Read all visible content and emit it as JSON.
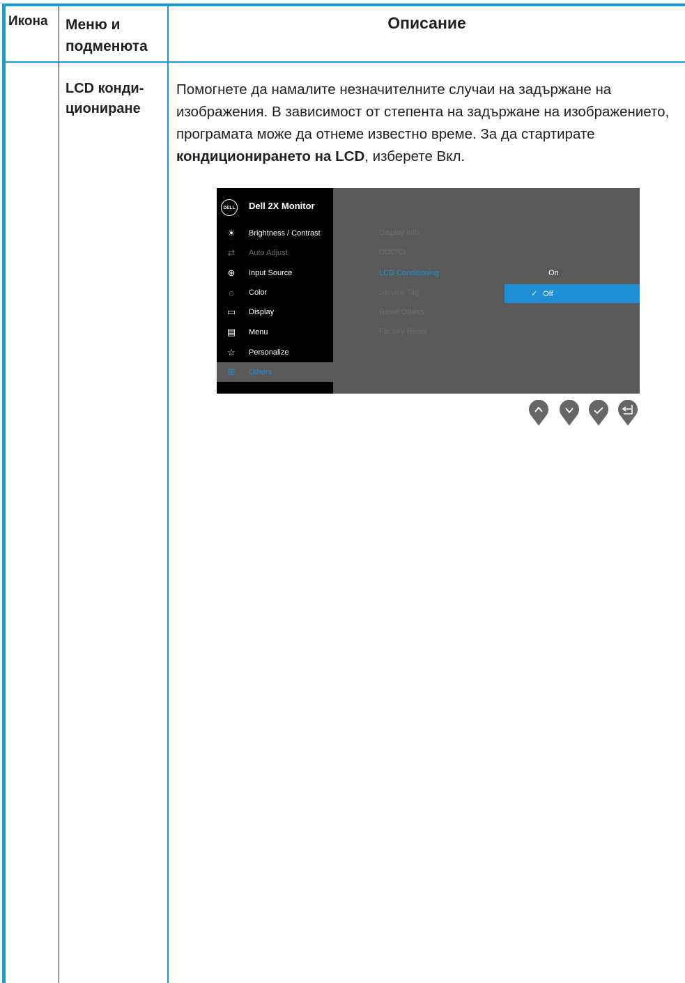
{
  "table": {
    "header": {
      "icon": "Икона",
      "menu": "Меню и подменюта",
      "description": "Описание"
    },
    "row": {
      "menu_name": "LCD конди-циониране",
      "description_part1": "Помогнете да намалите незначителните случаи на задържане на изображения. В зависимост от степента на задържане на изображението, програмата може да отнеме известно време. За да стартирате ",
      "description_bold": "кондиционирането на LCD",
      "description_part2": ", изберете Вкл."
    }
  },
  "osd": {
    "logo": "DELL",
    "title": "Dell 2X Monitor",
    "menu_items": [
      {
        "label": "Brightness / Contrast",
        "icon": "brightness-icon"
      },
      {
        "label": "Auto Adjust",
        "icon": "auto-adjust-icon"
      },
      {
        "label": "Input Source",
        "icon": "input-source-icon"
      },
      {
        "label": "Color",
        "icon": "color-icon"
      },
      {
        "label": "Display",
        "icon": "display-icon"
      },
      {
        "label": "Menu",
        "icon": "menu-icon"
      },
      {
        "label": "Personalize",
        "icon": "star-icon"
      },
      {
        "label": "Others",
        "icon": "others-icon"
      }
    ],
    "submenu": [
      "Display Info",
      "DDC/CI",
      "LCD Conditioning",
      "Service Tag",
      "Reset Others",
      "Factory Reset"
    ],
    "options": {
      "on": "On",
      "off": "Off"
    },
    "selected_option": "Off",
    "colors": {
      "accent": "#1f8fd4",
      "panel": "#595959",
      "rule": "#1a9bd7"
    }
  },
  "buttons": [
    "up-icon",
    "down-icon",
    "check-icon",
    "back-icon"
  ]
}
